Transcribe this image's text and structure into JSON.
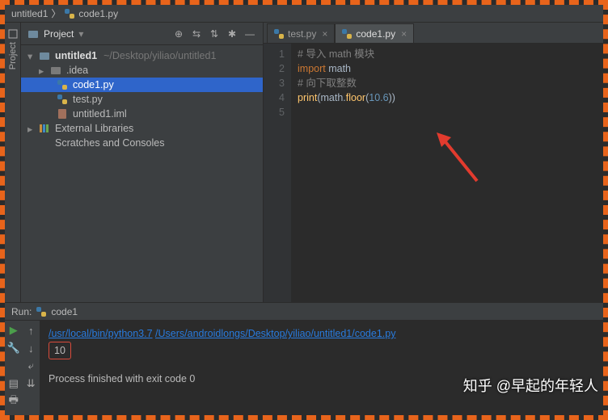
{
  "breadcrumb": {
    "project": "untitled1",
    "file": "code1.py"
  },
  "project_tool": {
    "label": "Project",
    "title": "Project"
  },
  "tree": {
    "root": {
      "name": "untitled1",
      "path": "~/Desktop/yiliao/untitled1"
    },
    "idea": ".idea",
    "code1": "code1.py",
    "test": "test.py",
    "iml": "untitled1.iml",
    "ext": "External Libraries",
    "scratch": "Scratches and Consoles"
  },
  "tabs": {
    "test": "test.py",
    "code1": "code1.py"
  },
  "code": {
    "lines": [
      "1",
      "2",
      "3",
      "4",
      "5"
    ],
    "l1": "# 导入 math 模块",
    "l2a": "import",
    "l2b": " math",
    "l3": "# 向下取整数",
    "l4a": "print",
    "l4b": "(math.",
    "l4c": "floor",
    "l4d": "(",
    "l4e": "10.6",
    "l4f": "))"
  },
  "run": {
    "label": "Run:",
    "config": "code1",
    "path1": "/usr/local/bin/python3.7",
    "path2": "/Users/androidlongs/Desktop/yiliao/untitled1/code1.py",
    "output": "10",
    "exit": "Process finished with exit code 0"
  },
  "watermark": "知乎 @早起的年轻人"
}
